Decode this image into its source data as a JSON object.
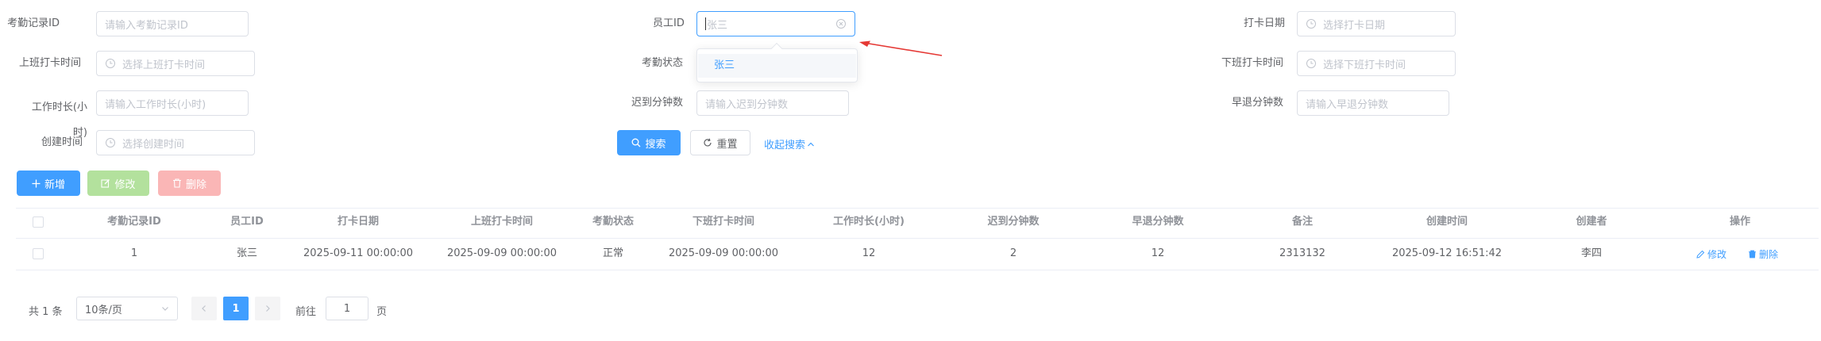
{
  "filters": {
    "attendance_id": {
      "label": "考勤记录ID",
      "placeholder": "请输入考勤记录ID"
    },
    "employee_id": {
      "label": "员工ID",
      "value": "张三"
    },
    "clock_date": {
      "label": "打卡日期",
      "placeholder": "选择打卡日期"
    },
    "checkin_time": {
      "label": "上班打卡时间",
      "placeholder": "选择上班打卡时间"
    },
    "status": {
      "label": "考勤状态"
    },
    "checkout_time": {
      "label": "下班打卡时间",
      "placeholder": "选择下班打卡时间"
    },
    "work_hours": {
      "label": "工作时长(小时)",
      "placeholder": "请输入工作时长(小时)"
    },
    "late_minutes": {
      "label": "迟到分钟数",
      "placeholder": "请输入迟到分钟数"
    },
    "early_minutes": {
      "label": "早退分钟数",
      "placeholder": "请输入早退分钟数"
    },
    "created_time": {
      "label": "创建时间",
      "placeholder": "选择创建时间"
    }
  },
  "dropdown": {
    "options": [
      "张三"
    ]
  },
  "search": {
    "search_label": "搜索",
    "reset_label": "重置",
    "collapse_label": "收起搜索"
  },
  "toolbar": {
    "add_label": "新增",
    "edit_label": "修改",
    "delete_label": "删除"
  },
  "table": {
    "headers": [
      "考勤记录ID",
      "员工ID",
      "打卡日期",
      "上班打卡时间",
      "考勤状态",
      "下班打卡时间",
      "工作时长(小时)",
      "迟到分钟数",
      "早退分钟数",
      "备注",
      "创建时间",
      "创建者",
      "操作"
    ],
    "rows": [
      {
        "id": "1",
        "employee": "张三",
        "date": "2025-09-11 00:00:00",
        "checkin": "2025-09-09 00:00:00",
        "status": "正常",
        "checkout": "2025-09-09 00:00:00",
        "hours": "12",
        "late": "2",
        "early": "12",
        "remark": "2313132",
        "created": "2025-09-12 16:51:42",
        "creator": "李四",
        "edit": "修改",
        "delete": "删除"
      }
    ]
  },
  "pagination": {
    "total": "共 1 条",
    "page_size": "10条/页",
    "current": "1",
    "goto_label": "前往",
    "goto_value": "1",
    "page_unit": "页"
  },
  "colors": {
    "primary": "#409eff",
    "success_disabled": "#b3e19d",
    "danger_disabled": "#fab6b6",
    "annotation_arrow": "#e53935"
  }
}
